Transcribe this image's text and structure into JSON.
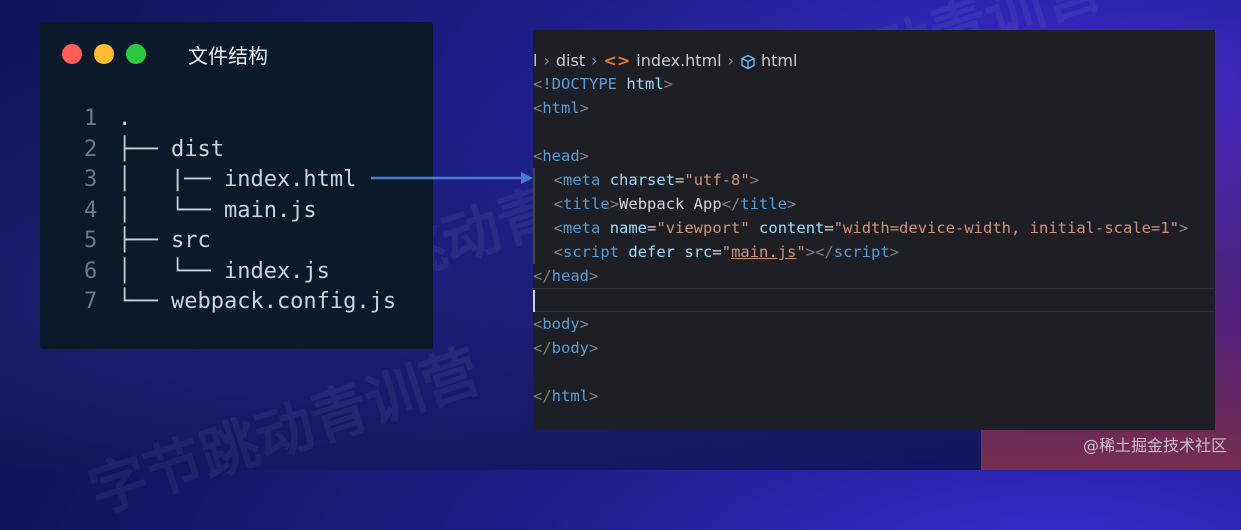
{
  "terminal": {
    "title": "文件结构",
    "traffic_colors": [
      "#ff5f57",
      "#febc2e",
      "#28c840"
    ],
    "lines": [
      {
        "num": "1",
        "text": "."
      },
      {
        "num": "2",
        "text": "├── dist"
      },
      {
        "num": "3",
        "text": "│   |── index.html"
      },
      {
        "num": "4",
        "text": "│   └── main.js"
      },
      {
        "num": "5",
        "text": "├── src"
      },
      {
        "num": "6",
        "text": "│   └── index.js"
      },
      {
        "num": "7",
        "text": "└── webpack.config.js"
      }
    ]
  },
  "editor": {
    "breadcrumb": {
      "root": "l",
      "folder": "dist",
      "file": "index.html",
      "symbol": "html"
    },
    "code": {
      "doctype_kw": "!DOCTYPE",
      "doctype_val": "html",
      "html_tag": "html",
      "head_tag": "head",
      "meta_tag": "meta",
      "charset_attr": "charset",
      "charset_val": "\"utf-8\"",
      "title_tag": "title",
      "title_text": "Webpack App",
      "name_attr": "name",
      "name_val": "\"viewport\"",
      "content_attr": "content",
      "content_val": "\"width=device-width, initial-scale=1\"",
      "script_tag": "script",
      "defer_attr": "defer",
      "src_attr": "src",
      "src_val": "main.js",
      "body_tag": "body"
    }
  },
  "watermarks": [
    "字节跳动青训营",
    "跳动青训营",
    "字节跳动青训营"
  ],
  "credit": "@稀土掘金技术社区"
}
